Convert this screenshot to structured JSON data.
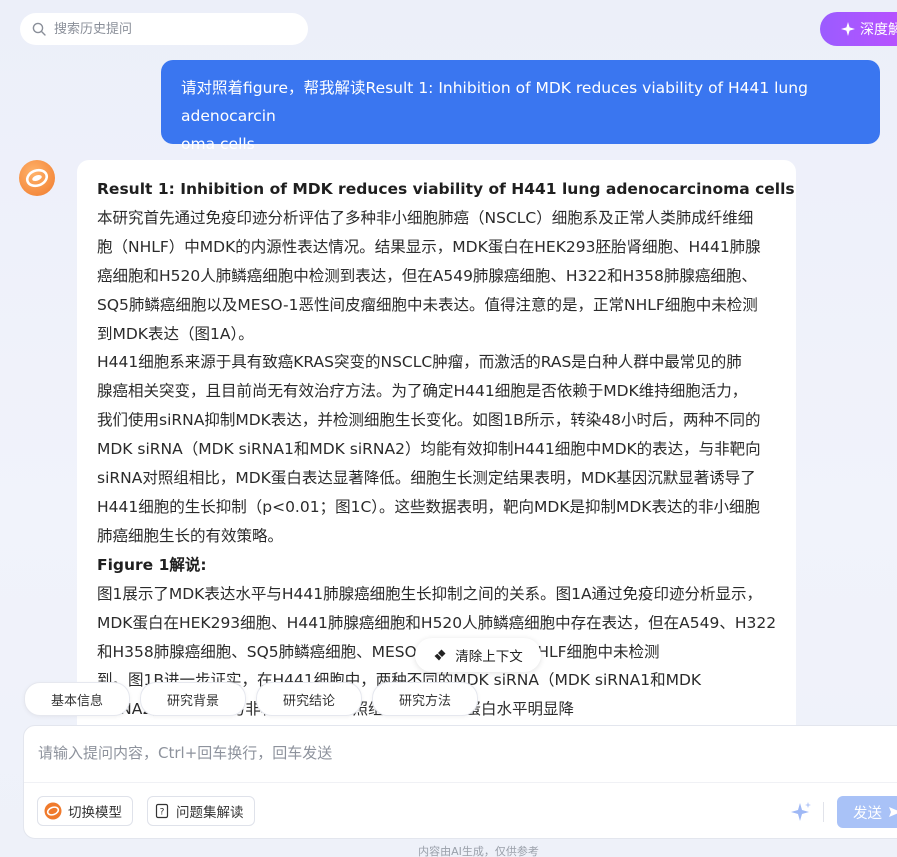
{
  "search": {
    "placeholder": "搜索历史提问"
  },
  "deep_button": {
    "label": "深度解读"
  },
  "user_message": {
    "lines": [
      "请对照着figure，帮我解读Result 1: Inhibition of MDK reduces viability of H441 lung adenocarcin",
      "oma cells"
    ]
  },
  "answer": {
    "lines": [
      "Result 1: Inhibition of MDK reduces viability of H441 lung adenocarcinoma cells",
      "本研究首先通过免疫印迹分析评估了多种非小细胞肺癌（NSCLC）细胞系及正常人类肺成纤维细",
      "胞（NHLF）中MDK的内源性表达情况。结果显示，MDK蛋白在HEK293胚胎肾细胞、H441肺腺",
      "癌细胞和H520人肺鳞癌细胞中检测到表达，但在A549肺腺癌细胞、H322和H358肺腺癌细胞、",
      "SQ5肺鳞癌细胞以及MESO-1恶性间皮瘤细胞中未表达。值得注意的是，正常NHLF细胞中未检测",
      "到MDK表达（图1A）。",
      "H441细胞系来源于具有致癌KRAS突变的NSCLC肿瘤，而激活的RAS是白种人群中最常见的肺",
      "腺癌相关突变，且目前尚无有效治疗方法。为了确定H441细胞是否依赖于MDK维持细胞活力，",
      "我们使用siRNA抑制MDK表达，并检测细胞生长变化。如图1B所示，转染48小时后，两种不同的",
      "MDK siRNA（MDK siRNA1和MDK siRNA2）均能有效抑制H441细胞中MDK的表达，与非靶向",
      "siRNA对照组相比，MDK蛋白表达显著降低。细胞生长测定结果表明，MDK基因沉默显著诱导了",
      "H441细胞的生长抑制（p<0.01；图1C）。这些数据表明，靶向MDK是抑制MDK表达的非小细胞",
      "肺癌细胞生长的有效策略。",
      "Figure 1解说:",
      "图1展示了MDK表达水平与H441肺腺癌细胞生长抑制之间的关系。图1A通过免疫印迹分析显示，",
      "MDK蛋白在HEK293细胞、H441肺腺癌细胞和H520人肺鳞癌细胞中存在表达，但在A549、H322",
      "和H358肺腺癌细胞、SQ5肺鳞癌细胞、MESO-1细胞以及正常NHLF细胞中未检测",
      "到。图1B进一步证实，在H441细胞中，两种不同的MDK siRNA（MDK siRNA1和MDK",
      "siRNA2）转染后，与非靶向siRNA对照组相比，MDK蛋白水平明显降"
    ]
  },
  "clear_context": {
    "label": "清除上下文"
  },
  "quick_chips": [
    "基本信息",
    "研究背景",
    "研究结论",
    "研究方法"
  ],
  "input": {
    "placeholder": "请输入提问内容，Ctrl+回车换行，回车发送"
  },
  "tools": {
    "switch_model": "切换模型",
    "question_set": "问题集解读"
  },
  "send_button": {
    "label": "发送"
  },
  "footnote": "内容由AI生成，仅供参考",
  "colors": {
    "primary": "#3a76f0",
    "deep_gradient_start": "#9b5cff",
    "send_disabled": "#a9c2f7",
    "avatar": "#f07a2c"
  }
}
